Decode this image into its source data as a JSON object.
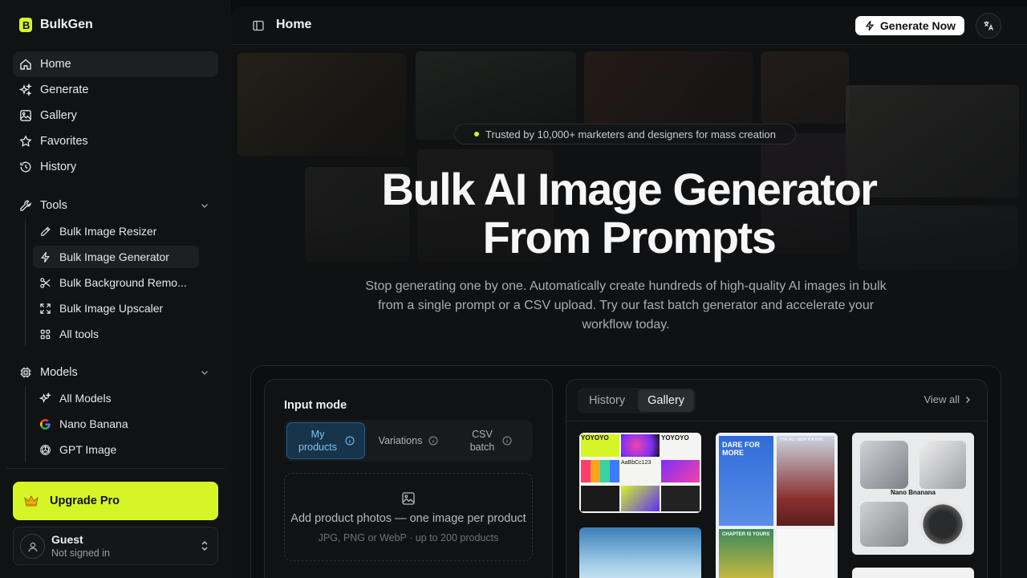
{
  "brand": {
    "name": "BulkGen",
    "accent": "#d6f527"
  },
  "nav": {
    "items": [
      {
        "label": "Home",
        "icon": "home-icon",
        "active": true
      },
      {
        "label": "Generate",
        "icon": "sparkles-icon"
      },
      {
        "label": "Gallery",
        "icon": "image-icon"
      },
      {
        "label": "Favorites",
        "icon": "star-icon"
      },
      {
        "label": "History",
        "icon": "history-icon"
      }
    ]
  },
  "tools": {
    "label": "Tools",
    "items": [
      {
        "label": "Bulk Image Resizer",
        "icon": "pencil-icon"
      },
      {
        "label": "Bulk Image Generator",
        "icon": "bolt-icon",
        "active": true
      },
      {
        "label": "Bulk Background Remo...",
        "icon": "scissors-icon"
      },
      {
        "label": "Bulk Image Upscaler",
        "icon": "expand-icon"
      },
      {
        "label": "All tools",
        "icon": "grid-icon"
      }
    ]
  },
  "models": {
    "label": "Models",
    "items": [
      {
        "label": "All Models",
        "icon": "sparkles-icon"
      },
      {
        "label": "Nano Banana",
        "icon": "google-icon"
      },
      {
        "label": "GPT Image",
        "icon": "openai-icon"
      }
    ]
  },
  "upgrade": {
    "label": "Upgrade Pro",
    "icon": "crown-icon"
  },
  "user": {
    "name": "Guest",
    "status": "Not signed in"
  },
  "topbar": {
    "title": "Home",
    "generate_label": "Generate Now",
    "lang_icon": "translate-icon"
  },
  "hero": {
    "badge": "Trusted by 10,000+ marketers and designers for mass creation",
    "title_line1": "Bulk AI Image Generator",
    "title_line2": "From Prompts",
    "subtitle": "Stop generating one by one. Automatically create hundreds of high-quality AI images in bulk from a single prompt or a CSV upload. Try our fast batch generator and accelerate your workflow today."
  },
  "input": {
    "label": "Input mode",
    "modes": [
      {
        "label": "My products",
        "active": true
      },
      {
        "label": "Variations"
      },
      {
        "label": "CSV batch"
      }
    ],
    "drop_title": "Add product photos — one image per product",
    "drop_hint": "JPG, PNG or WebP · up to 200 products"
  },
  "gallery": {
    "tabs": [
      {
        "label": "History"
      },
      {
        "label": "Gallery",
        "active": true
      }
    ],
    "view_all": "View all",
    "thumb_texts": {
      "brand_book": "YOYOYO",
      "type_sample": "AaBbCc123",
      "ad_headline": "DARE FOR MORE",
      "ad_tagline": "THE ALL-NEW KIA EV6",
      "ad_chapter": "CHAPTER IS YOURS",
      "product_label": "Nano Bnanana"
    }
  }
}
